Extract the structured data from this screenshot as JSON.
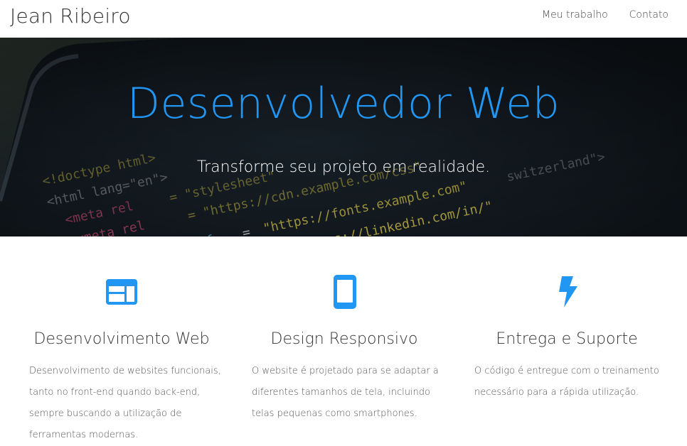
{
  "header": {
    "brand": "Jean Ribeiro",
    "nav": [
      "Meu trabalho",
      "Contato"
    ]
  },
  "hero": {
    "title": "Desenvolvedor Web",
    "subtitle": "Transforme seu projeto em realidade."
  },
  "features": [
    {
      "icon": "browser-window-icon",
      "title": "Desenvolvimento Web",
      "desc_lines": [
        "Desenvolvimento de websites funcionais,",
        "tanto no front-end quando back-end,",
        "sempre buscando a utilização de",
        "ferramentas modernas."
      ]
    },
    {
      "icon": "smartphone-icon",
      "title": "Design Responsivo",
      "desc_lines": [
        "O website é projetado para se adaptar a",
        "diferentes tamanhos de tela, incluindo",
        "telas pequenas como smartphones."
      ]
    },
    {
      "icon": "lightning-bolt-icon",
      "title": "Entrega e Suporte",
      "desc_lines": [
        "O código é entregue com o treinamento",
        "necessário para a rápida utilização."
      ]
    }
  ],
  "colors": {
    "accent": "#2196f3",
    "hero_text": "#ffffff"
  }
}
